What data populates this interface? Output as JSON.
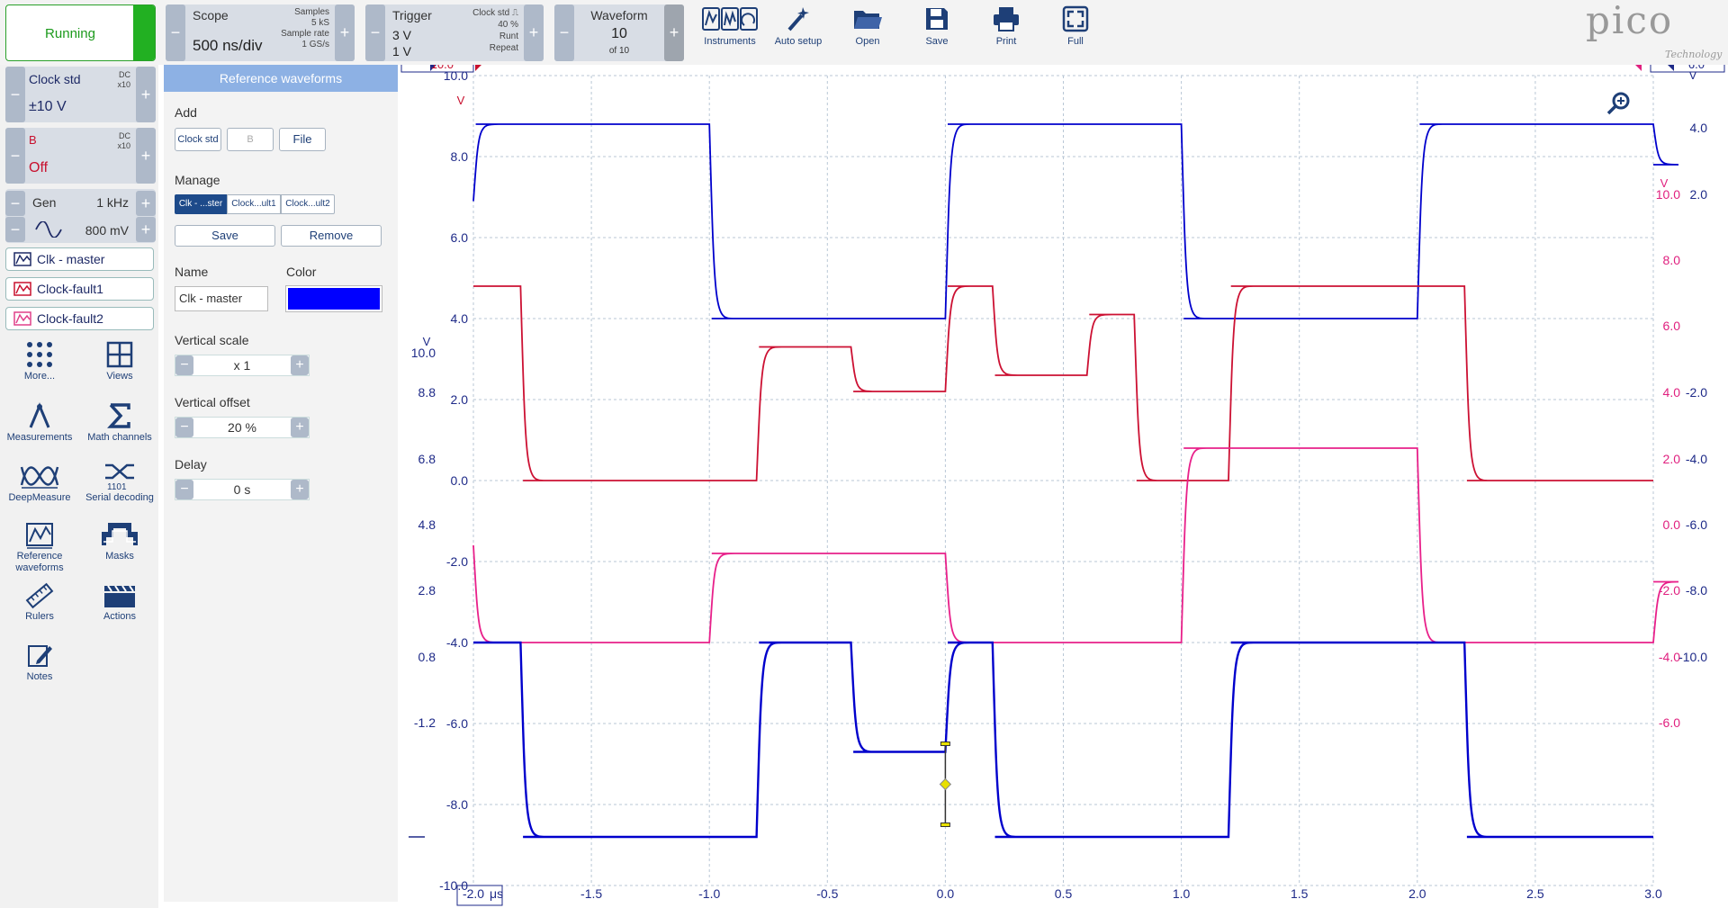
{
  "toolbar": {
    "run_label": "Running",
    "scope": {
      "title": "Scope",
      "timebase": "500 ns/div",
      "samples_label": "Samples",
      "samples": "5 kS",
      "sample_rate_label": "Sample rate",
      "sample_rate": "1 GS/s"
    },
    "trigger": {
      "title": "Trigger",
      "level": "3 V",
      "level2": "1 V",
      "source": "Clock std",
      "percent": "40 %",
      "type": "Runt",
      "mode": "Repeat"
    },
    "waveform": {
      "title": "Waveform",
      "current": "10",
      "of": "of 10"
    },
    "tools": [
      {
        "label": "Instruments",
        "icon": "instruments-icon"
      },
      {
        "label": "Auto setup",
        "icon": "wand-icon"
      },
      {
        "label": "Open",
        "icon": "folder-icon"
      },
      {
        "label": "Save",
        "icon": "floppy-icon"
      },
      {
        "label": "Print",
        "icon": "printer-icon"
      },
      {
        "label": "Full",
        "icon": "fullscreen-icon"
      }
    ],
    "logo": "pico",
    "logo_sub": "Technology"
  },
  "sidebar": {
    "ch_a": {
      "name": "Clock std",
      "coupling": "DC",
      "probe": "x10",
      "range": "±10 V"
    },
    "ch_b": {
      "name": "B",
      "coupling": "DC",
      "probe": "x10",
      "range": "Off"
    },
    "gen": {
      "label": "Gen",
      "freq": "1 kHz",
      "amp": "800 mV"
    },
    "refs": [
      "Clk - master",
      "Clock-fault1",
      "Clock-fault2"
    ],
    "icons": [
      {
        "label": "More...",
        "icon": "more-dots-icon"
      },
      {
        "label": "Views",
        "icon": "views-grid-icon"
      },
      {
        "label": "Measurements",
        "icon": "measurements-icon"
      },
      {
        "label": "Math channels",
        "icon": "sigma-icon"
      },
      {
        "label": "DeepMeasure",
        "icon": "deepmeasure-icon"
      },
      {
        "label": "Serial decoding",
        "icon": "serial-decoding-icon"
      },
      {
        "label": "Reference waveforms",
        "icon": "reference-waveforms-icon"
      },
      {
        "label": "Masks",
        "icon": "masks-icon"
      },
      {
        "label": "Rulers",
        "icon": "ruler-icon"
      },
      {
        "label": "Actions",
        "icon": "clapper-icon"
      },
      {
        "label": "Notes",
        "icon": "notes-icon"
      }
    ]
  },
  "refpanel": {
    "title": "Reference waveforms",
    "add_label": "Add",
    "add_buttons": [
      "Clock std",
      "B",
      "File"
    ],
    "manage_label": "Manage",
    "manage_tabs": [
      "Clk - ...ster",
      "Clock...ult1",
      "Clock...ult2"
    ],
    "save": "Save",
    "remove": "Remove",
    "name_label": "Name",
    "name_value": "Clk - master",
    "color_label": "Color",
    "color_value": "#0000ff",
    "vscale_label": "Vertical scale",
    "vscale": "x 1",
    "voffset_label": "Vertical offset",
    "voffset": "20 %",
    "delay_label": "Delay",
    "delay": "0 s"
  },
  "plot": {
    "x_unit": "μs",
    "x_ticks": [
      "-2.0",
      "-1.5",
      "-1.0",
      "-0.5",
      "0.0",
      "0.5",
      "1.0",
      "1.5",
      "2.0",
      "2.5",
      "3.0"
    ],
    "axis1_ticks": [
      "10.0",
      "8.0",
      "6.0",
      "4.0",
      "2.0",
      "0.0",
      "-2.0",
      "-4.0",
      "-6.0",
      "-8.0",
      "-10.0"
    ],
    "axis1_unit": "V",
    "axis2_ticks": [
      "10.0",
      "8.8",
      "6.8",
      "4.8",
      "2.8",
      "0.8",
      "-1.2"
    ],
    "axis2_unit": "V",
    "axis3_ticks": [
      "10.0",
      "8.0",
      "6.0",
      "4.0",
      "2.0",
      "0.0",
      "-2.0",
      "-4.0",
      "-6.0"
    ],
    "axis3_unit": "V",
    "axis4_ticks": [
      "6.0",
      "4.0",
      "2.0",
      "-2.0",
      "-4.0",
      "-6.0",
      "-8.0",
      "-10.0"
    ],
    "axis4_unit": "V",
    "colors": {
      "blue": "#0000cc",
      "red": "#cc1133",
      "pink": "#e8208a"
    }
  }
}
